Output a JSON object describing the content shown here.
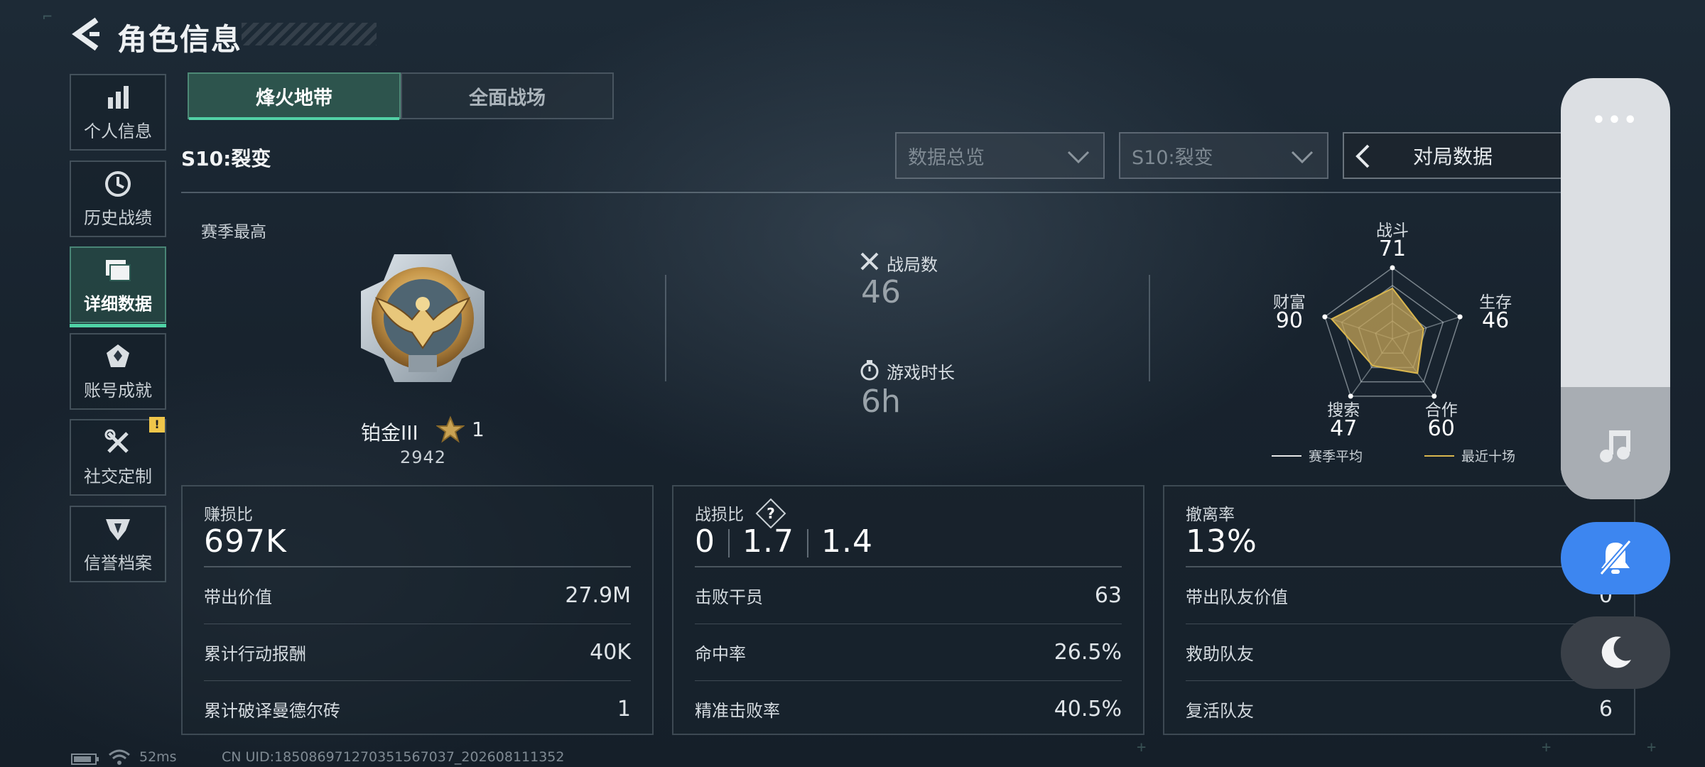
{
  "header": {
    "title": "角色信息"
  },
  "sidebar": {
    "items": [
      {
        "label": "个人信息",
        "icon": "bar-chart-icon"
      },
      {
        "label": "历史战绩",
        "icon": "clock-icon"
      },
      {
        "label": "详细数据",
        "icon": "folder-icon",
        "active": true
      },
      {
        "label": "账号成就",
        "icon": "achievement-icon"
      },
      {
        "label": "社交定制",
        "icon": "tools-icon",
        "badge": "!"
      },
      {
        "label": "信誉档案",
        "icon": "shield-icon"
      }
    ]
  },
  "tabs": [
    {
      "label": "烽火地带",
      "active": true
    },
    {
      "label": "全面战场",
      "active": false
    }
  ],
  "season": "S10:裂变",
  "filters": {
    "overview_dropdown": "数据总览",
    "season_dropdown": "S10:裂变",
    "match_data_button": "对局数据"
  },
  "overview": {
    "season_best_label": "赛季最高",
    "rank": {
      "name": "铂金III",
      "stars": "1",
      "score": "2942",
      "medal_numeral": "III"
    },
    "matches": {
      "label": "战局数",
      "value": "46"
    },
    "play_time": {
      "label": "游戏时长",
      "value": "6h"
    }
  },
  "radar": {
    "axes": [
      {
        "label": "战斗",
        "value": "71"
      },
      {
        "label": "生存",
        "value": "46"
      },
      {
        "label": "合作",
        "value": "60"
      },
      {
        "label": "搜索",
        "value": "47"
      },
      {
        "label": "财富",
        "value": "90"
      }
    ],
    "legend": {
      "season_avg": "赛季平均",
      "recent_ten": "最近十场"
    },
    "colors": {
      "season_avg": "#e6e6e6",
      "recent_ten": "#d9b64e"
    }
  },
  "cards": {
    "profit": {
      "title": "赚损比",
      "main": "697K",
      "rows": [
        {
          "label": "带出价值",
          "value": "27.9M"
        },
        {
          "label": "累计行动报酬",
          "value": "40K"
        },
        {
          "label": "累计破译曼德尔砖",
          "value": "1"
        }
      ]
    },
    "combat": {
      "title": "战损比",
      "main_parts": [
        "0",
        "1.7",
        "1.4"
      ],
      "rows": [
        {
          "label": "击败干员",
          "value": "63"
        },
        {
          "label": "命中率",
          "value": "26.5%"
        },
        {
          "label": "精准击败率",
          "value": "40.5%"
        }
      ]
    },
    "extraction": {
      "title": "撤离率",
      "main": "13%",
      "rows": [
        {
          "label": "带出队友价值",
          "value": "0"
        },
        {
          "label": "救助队友",
          "value": ""
        },
        {
          "label": "复活队友",
          "value": "6"
        }
      ]
    }
  },
  "footer": {
    "ping": "52ms",
    "uid": "CN UID:1850869712703515670​37_202608111352"
  },
  "overlay": {
    "more": "•••"
  },
  "colors": {
    "accent_green": "#4fd3a6",
    "overlay_blue": "#3d86f0"
  }
}
